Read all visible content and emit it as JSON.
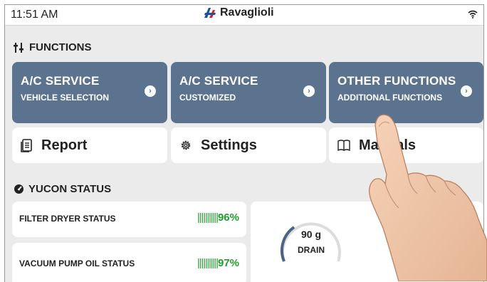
{
  "statusbar": {
    "time": "11:51 AM",
    "brand": "Ravaglioli"
  },
  "functions": {
    "title": "FUNCTIONS",
    "tiles": [
      {
        "title": "A/C SERVICE",
        "subtitle": "VEHICLE SELECTION"
      },
      {
        "title": "A/C SERVICE",
        "subtitle": "CUSTOMIZED"
      },
      {
        "title": "OTHER FUNCTIONS",
        "subtitle": "ADDITIONAL FUNCTIONS"
      }
    ],
    "buttons": [
      {
        "label": "Report"
      },
      {
        "label": "Settings"
      },
      {
        "label": "Manuals"
      }
    ]
  },
  "status": {
    "title": "YUCON STATUS",
    "items": [
      {
        "label": "FILTER DRYER STATUS",
        "value": "96%",
        "fraction": 0.96
      },
      {
        "label": "VACUUM PUMP OIL STATUS",
        "value": "97%",
        "fraction": 0.97
      }
    ],
    "gauge": {
      "value": "90 g",
      "label": "DRAIN"
    }
  },
  "colors": {
    "tile": "#5c7390",
    "accent_green": "#1e9e2a",
    "brand_red": "#d6232a",
    "brand_blue": "#1d4f9a"
  }
}
